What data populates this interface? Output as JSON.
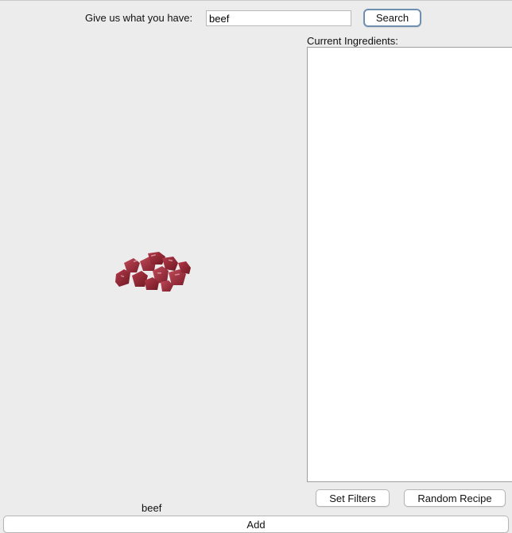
{
  "search": {
    "label": "Give us what you have:",
    "value": "beef",
    "button_label": "Search"
  },
  "ingredients": {
    "label": "Current Ingredients:",
    "items": []
  },
  "preview": {
    "image_icon": "beef-chunks-image",
    "caption": "beef"
  },
  "actions": {
    "set_filters_label": "Set Filters",
    "random_recipe_label": "Random Recipe",
    "add_label": "Add"
  },
  "colors": {
    "background": "#ececec",
    "focus_ring": "#6f8fb0",
    "meat": "#a3303f"
  }
}
